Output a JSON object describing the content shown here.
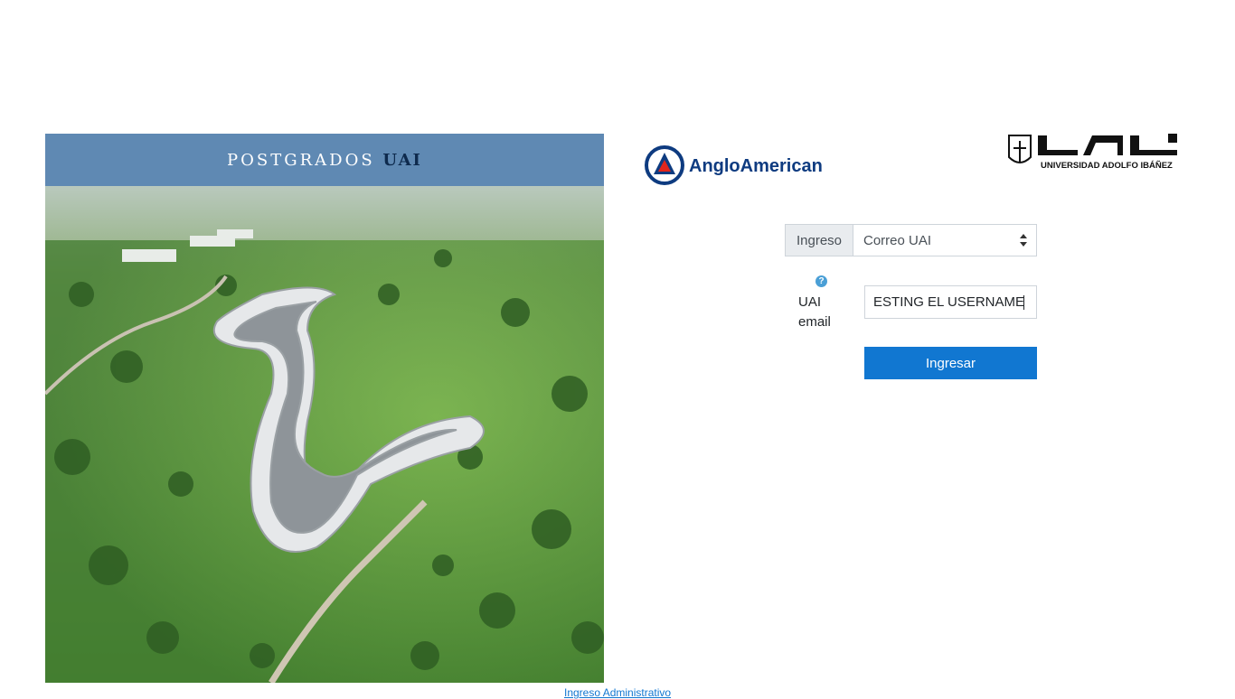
{
  "banner": {
    "title_main": "POSTGRADOS",
    "title_accent": "UAI"
  },
  "logos": {
    "anglo_text": "AngloAmerican",
    "uai_text": "UNIVERSIDAD ADOLFO IBÁÑEZ",
    "uai_wordmark": "UAI"
  },
  "login": {
    "ingreso_label": "Ingreso",
    "ingreso_selected": "Correo UAI",
    "help_symbol": "?",
    "email_label": "UAI email",
    "email_value": "ESTING EL USERNAME",
    "submit_label": "Ingresar"
  },
  "footer": {
    "admin_link": "Ingreso Administrativo"
  },
  "colors": {
    "banner": "#5f89b3",
    "accent_dark": "#0e2a4d",
    "primary_button": "#1177d1",
    "anglo_blue": "#0e3b80",
    "anglo_red": "#e1261c"
  }
}
